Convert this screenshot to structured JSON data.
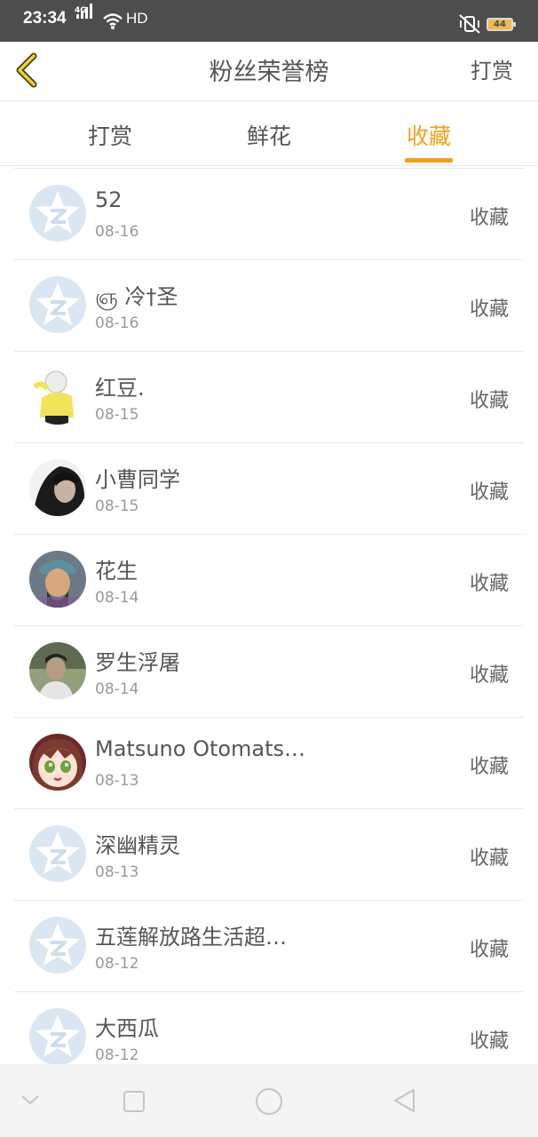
{
  "status": {
    "time": "23:34",
    "network": "4G",
    "hd": "HD",
    "battery": "44"
  },
  "header": {
    "title": "粉丝荣誉榜",
    "action": "打赏"
  },
  "tabs": [
    {
      "label": "打赏",
      "active": false
    },
    {
      "label": "鲜花",
      "active": false
    },
    {
      "label": "收藏",
      "active": true
    }
  ],
  "accent": "#f2a01d",
  "fans": [
    {
      "name": "52",
      "date": "08-16",
      "action": "收藏",
      "avatar": "default"
    },
    {
      "name": "ஞ 冷†圣",
      "date": "08-16",
      "action": "收藏",
      "avatar": "default"
    },
    {
      "name": "红豆.",
      "date": "08-15",
      "action": "收藏",
      "avatar": "cartoon-yellow"
    },
    {
      "name": "小曹同学",
      "date": "08-15",
      "action": "收藏",
      "avatar": "dark-portrait"
    },
    {
      "name": "花生",
      "date": "08-14",
      "action": "收藏",
      "avatar": "warrior-portrait"
    },
    {
      "name": "罗生浮屠",
      "date": "08-14",
      "action": "收藏",
      "avatar": "photo-portrait"
    },
    {
      "name": "Matsuno Otomats…",
      "date": "08-13",
      "action": "收藏",
      "avatar": "anime-girl"
    },
    {
      "name": "深幽精灵",
      "date": "08-13",
      "action": "收藏",
      "avatar": "default"
    },
    {
      "name": "五莲解放路生活超…",
      "date": "08-12",
      "action": "收藏",
      "avatar": "default"
    },
    {
      "name": "大西瓜",
      "date": "08-12",
      "action": "收藏",
      "avatar": "default"
    }
  ]
}
